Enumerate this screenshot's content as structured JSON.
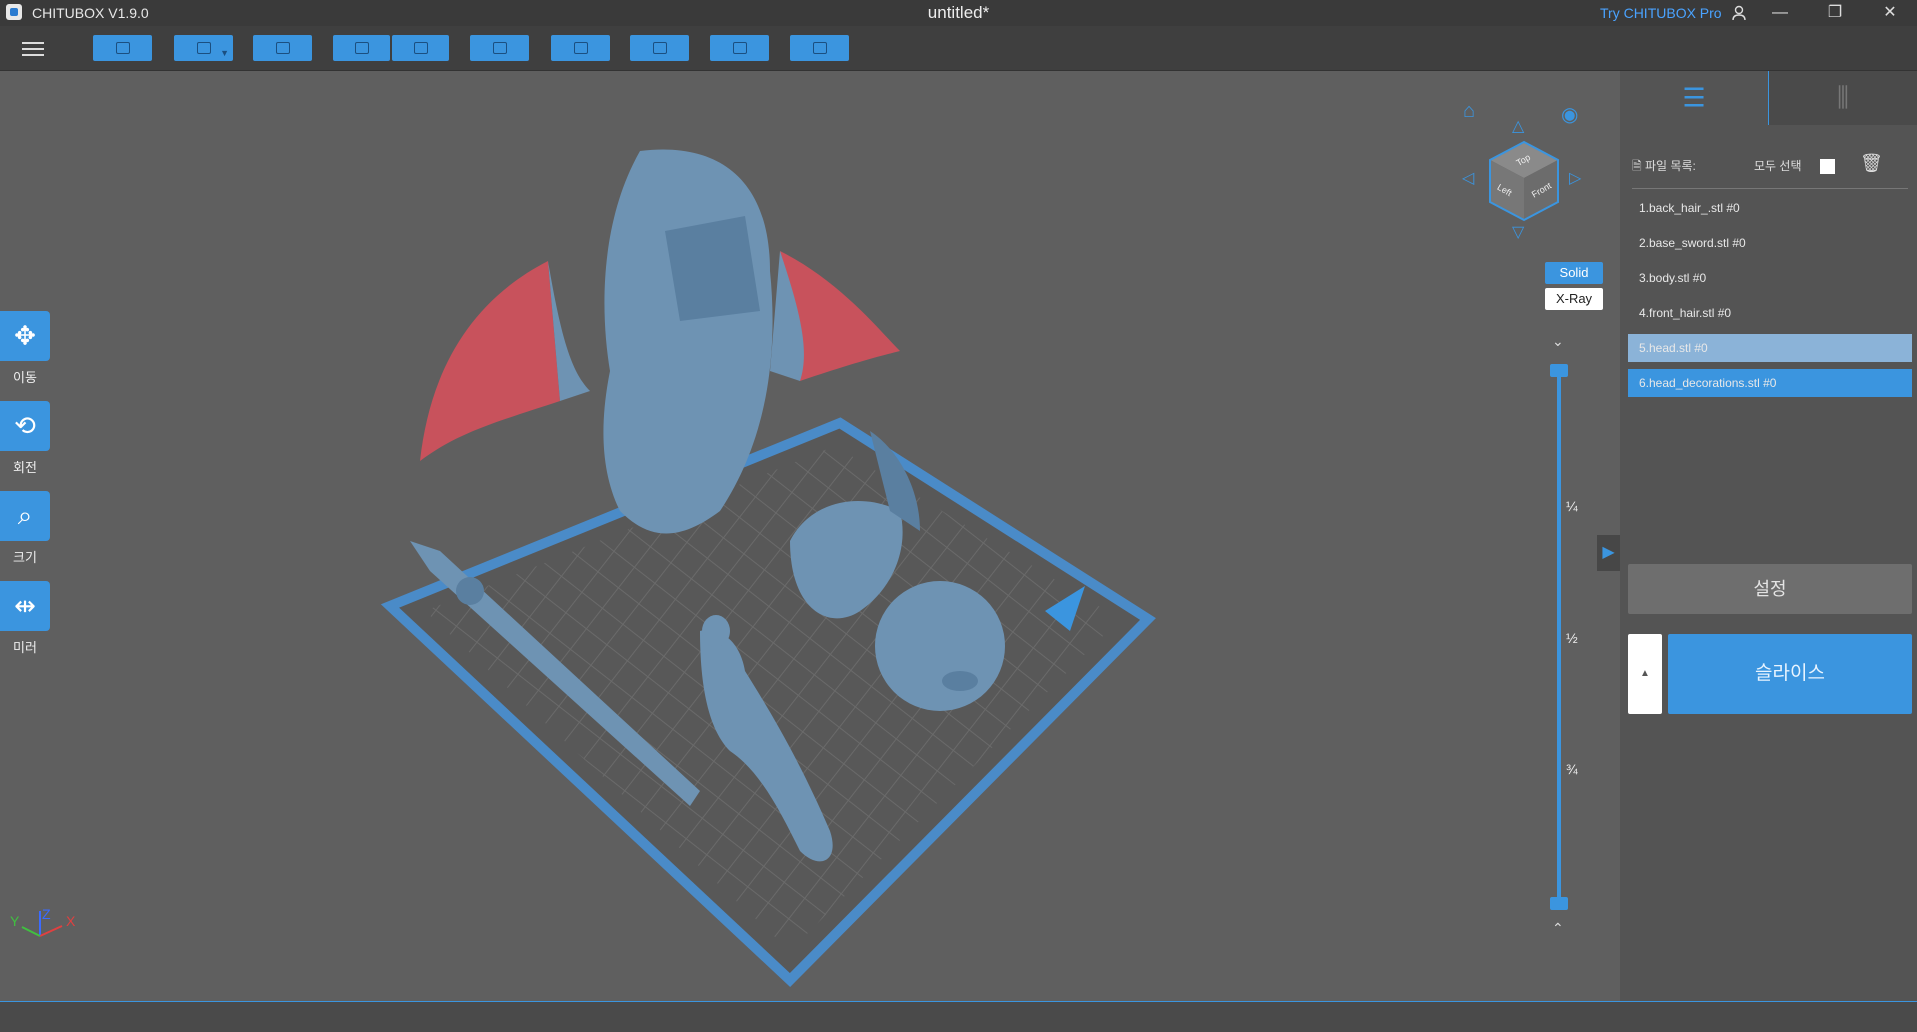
{
  "app": {
    "name": "CHITUBOX V1.9.0",
    "document_title": "untitled*",
    "try_pro": "Try CHITUBOX Pro"
  },
  "window_controls": {
    "minimize": "—",
    "restore": "❐",
    "close": "✕",
    "user": "user-icon"
  },
  "toolbar": {
    "items": [
      "open-file-icon",
      "save-icon",
      "auto-layout-icon",
      "undo-icon",
      "redo-icon",
      "slice-settings-icon",
      "hollow-icon",
      "supports-icon",
      "machine-icon",
      "export-icon"
    ]
  },
  "left_tools": [
    {
      "label": "이동",
      "icon": "move-icon",
      "glyph": "✥"
    },
    {
      "label": "회전",
      "icon": "rotate-icon",
      "glyph": "⟲"
    },
    {
      "label": "크기",
      "icon": "scale-icon",
      "glyph": "⌕"
    },
    {
      "label": "미러",
      "icon": "mirror-icon",
      "glyph": "⇹"
    }
  ],
  "view": {
    "cube_faces": [
      "Top",
      "Left",
      "Front"
    ],
    "solid_label": "Solid",
    "xray_label": "X-Ray",
    "slider_marks": [
      "¼",
      "½",
      "¾"
    ],
    "axis_labels": {
      "x": "X",
      "y": "Y",
      "z": "Z"
    }
  },
  "right_panel": {
    "tabs": [
      {
        "name": "settings-tab",
        "icon": "list-gear-icon"
      },
      {
        "name": "supports-tab",
        "icon": "supports-icon"
      }
    ],
    "file_list_label": "파일 목록:",
    "select_all_label": "모두 선택",
    "files": [
      {
        "name": "1.back_hair_.stl #0",
        "state": "normal"
      },
      {
        "name": "2.base_sword.stl #0",
        "state": "normal"
      },
      {
        "name": "3.body.stl #0",
        "state": "normal"
      },
      {
        "name": "4.front_hair.stl #0",
        "state": "normal"
      },
      {
        "name": "5.head.stl #0",
        "state": "selected-light"
      },
      {
        "name": "6.head_decorations.stl #0",
        "state": "selected"
      }
    ],
    "settings_button": "설정",
    "slice_button": "슬라이스",
    "slice_arrow": "▲"
  },
  "colors": {
    "accent": "#3b95df",
    "model": "#6e93b3",
    "wing": "#c8525c",
    "plate": "#4a8bc8"
  }
}
